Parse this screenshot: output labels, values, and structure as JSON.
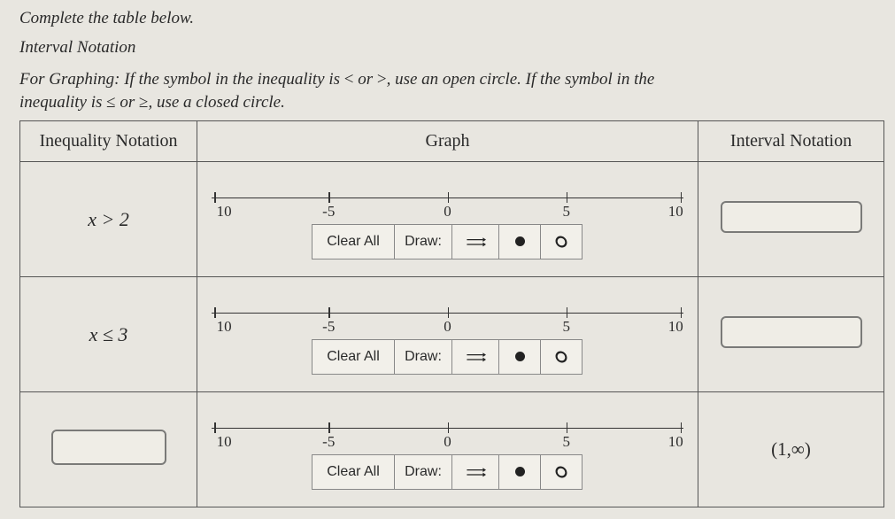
{
  "header": {
    "title_a": "Complete the table below.",
    "title_b": "Interval Notation",
    "instr_a": "For Graphing: If the symbol in the inequality is ",
    "sym_lt": "<",
    "instr_or": " or ",
    "sym_gt": ">",
    "instr_b": ", use an open circle. If the symbol in the",
    "instr_c": "inequality is ",
    "sym_le": "≤",
    "sym_ge": "≥",
    "instr_d": ", use a closed circle."
  },
  "columns": {
    "c1": "Inequality Notation",
    "c2": "Graph",
    "c3": "Interval Notation"
  },
  "axis": {
    "t0": "10",
    "t1": "-5",
    "t2": "0",
    "t3": "5",
    "t4": "10"
  },
  "tools": {
    "clear": "Clear All",
    "draw": "Draw:"
  },
  "rows": {
    "r1": {
      "ineq_pre": "x",
      "ineq_op": " > ",
      "ineq_val": "2",
      "interval": ""
    },
    "r2": {
      "ineq_pre": "x",
      "ineq_op": " ≤ ",
      "ineq_val": "3",
      "interval": ""
    },
    "r3": {
      "interval": "(1,∞)"
    }
  }
}
